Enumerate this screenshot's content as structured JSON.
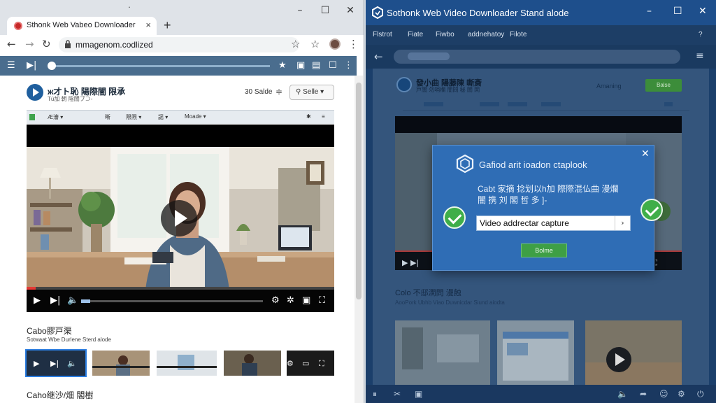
{
  "browser": {
    "tab_title": "Sthonk Web Vabeo Downloader",
    "tab_close": "×",
    "new_tab": "+",
    "window_controls": {
      "minimize": "–",
      "maximize": "☐",
      "close": "✕"
    },
    "nav": {
      "back": "←",
      "forward": "→",
      "reload": "↻"
    },
    "url": "mmagenom.codlized",
    "menu_icon": "⋮"
  },
  "site": {
    "title": "ж才ト恥 陽際闇 限承",
    "subtitle": "Tü加 朝 陰闇ブ⊃-",
    "count_label": "30 Salde",
    "search_label": "Selle",
    "menu_items": [
      "Ӕ瀋 ▾",
      "晰",
      "限限 ▾",
      "謡 ▾",
      "Moade ▾"
    ],
    "progress_fraction": 0.03,
    "volume_fraction": 0.05,
    "section_title": "Cabo膠戸渠",
    "section_sub": "Sotwaat Wbe Durlene     Sterd alode",
    "bottom_title": "Caho继沙/畑 閣樹"
  },
  "app": {
    "title": "Sothonk Web Video Downloader Stand alode",
    "menu": [
      "Flstrot",
      "Fiate",
      "Fiwbo",
      "addnehatoy",
      "Filote"
    ],
    "page_title": "發小曲 陽藤陳 嘶斎",
    "page_sub": "戸闇 勿哨欄 闇問 秘 闇 閑",
    "arriving": "Amaning",
    "green_button": "Balse",
    "section_title": "Colo 不邸澗問 漫蝕",
    "section_sub": "AooPork Ubhb Viao Duwnicdar      Siund aiodta"
  },
  "dialog": {
    "title": "Gafiod arit ioadon ctaplook",
    "text_line1": "Cabt 家摘 捻划以h加 際際混仏曲 漫爛",
    "text_line2": "闇 携 刘 閣 哲 多 ]-",
    "input_value": "Video addrectar capture",
    "button": "Bolme",
    "close": "✕"
  },
  "colors": {
    "accent_blue": "#2f6db5",
    "success_green": "#3fae49",
    "progress_red": "#e53935"
  },
  "icons": [
    "shield-icon",
    "checkmark-icon",
    "play-icon",
    "settings-icon",
    "fullscreen-icon",
    "volume-icon"
  ]
}
